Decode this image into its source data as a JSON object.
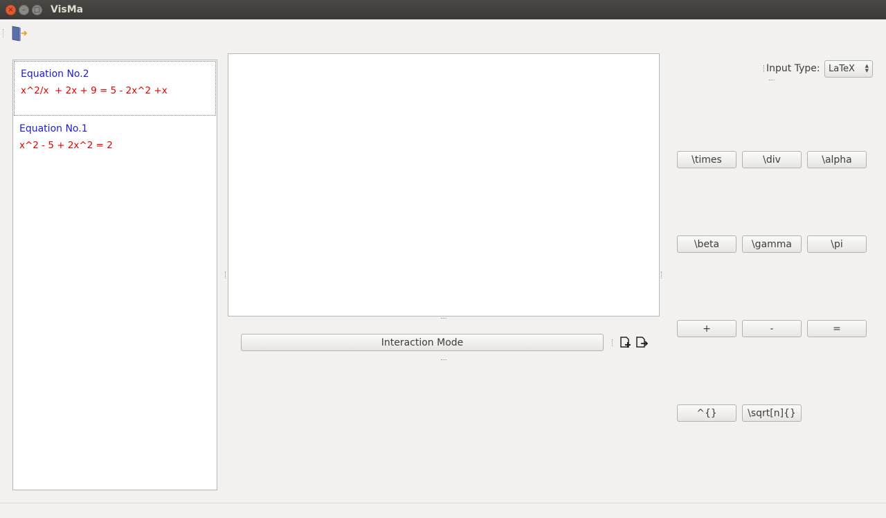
{
  "window": {
    "title": "VisMa"
  },
  "equations": [
    {
      "name": "Equation No.2",
      "expr": "x^2/x  + 2x + 9 = 5 - 2x^2 +x"
    },
    {
      "name": "Equation No.1",
      "expr": "x^2 - 5 + 2x^2 = 2"
    }
  ],
  "interaction": {
    "label": "Interaction Mode"
  },
  "input_type": {
    "label": "Input Type:",
    "value": "LaTeX"
  },
  "keys": [
    [
      "\\times",
      "\\div",
      "\\alpha"
    ],
    [
      "\\beta",
      "\\gamma",
      "\\pi"
    ],
    [
      "+",
      "-",
      "="
    ],
    [
      "^{}",
      "\\sqrt[n]{}"
    ]
  ],
  "colors": {
    "equation_name": "#1c1ccf",
    "equation_expr": "#e00000",
    "close_button": "#e25a32"
  },
  "icons": {
    "exit": "exit-door-icon",
    "add_file": "add-file-icon",
    "export_file": "export-file-icon"
  }
}
